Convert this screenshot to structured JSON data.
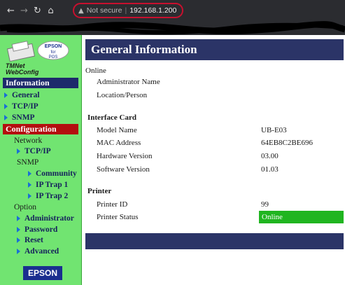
{
  "browser": {
    "not_secure": "Not secure",
    "url": "192.168.1.200"
  },
  "sidebar": {
    "logo_text": "EPSON for POS",
    "brand": "TMNet WebConfig",
    "information_heading": "Information",
    "info_items": [
      "General",
      "TCP/IP",
      "SNMP"
    ],
    "configuration_heading": "Configuration",
    "network_label": "Network",
    "tcpip_label": "TCP/IP",
    "snmp_label": "SNMP",
    "community_label": "Community",
    "iptrap1_label": "IP Trap 1",
    "iptrap2_label": "IP Trap 2",
    "option_label": "Option",
    "administrator_label": "Administrator",
    "password_label": "Password",
    "reset_label": "Reset",
    "advanced_label": "Advanced",
    "epson_badge": "EPSON"
  },
  "main": {
    "title": "General Information",
    "online_label": "Online",
    "admin_name_label": "Administrator Name",
    "location_label": "Location/Person",
    "interface_heading": "Interface Card",
    "model_name_label": "Model Name",
    "model_name_value": "UB-E03",
    "mac_label": "MAC Address",
    "mac_value": "64EB8C2BE696",
    "hw_label": "Hardware Version",
    "hw_value": "03.00",
    "sw_label": "Software Version",
    "sw_value": "01.03",
    "printer_heading": "Printer",
    "printer_id_label": "Printer ID",
    "printer_id_value": "99",
    "printer_status_label": "Printer Status",
    "printer_status_value": "Online"
  },
  "colors": {
    "sidebar_bg": "#71e471",
    "heading_bg": "#1d2a6b",
    "config_heading_bg": "#b30f0f",
    "title_bar": "#2b3467",
    "status_online": "#20b520"
  }
}
